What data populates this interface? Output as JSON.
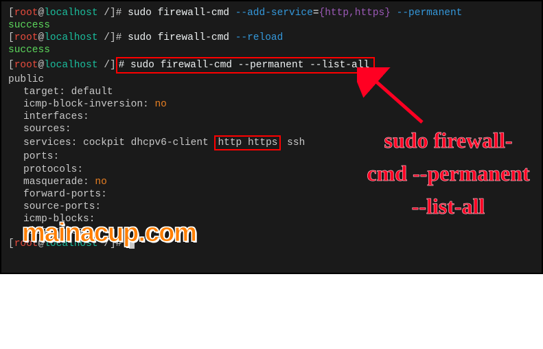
{
  "prompt": {
    "user": "root",
    "at": "@",
    "host": "localhost",
    "path": " /",
    "suffix": "]# "
  },
  "lines": {
    "cmd1_sudo": "sudo ",
    "cmd1_fw": "firewall-cmd ",
    "cmd1_add": "--add-service",
    "cmd1_eq": "=",
    "cmd1_val": "{http,https}",
    "cmd1_perm": " --permanent",
    "success": "success",
    "cmd2_sudo": "sudo ",
    "cmd2_fw": "firewall-cmd ",
    "cmd2_reload": "--reload",
    "cmd3_full": "# sudo firewall-cmd --permanent --list-all",
    "out_public": "public",
    "out_target": "target: default",
    "out_icmp": "icmp-block-inversion: ",
    "out_no": "no",
    "out_interfaces": "interfaces:",
    "out_sources": "sources:",
    "out_services_pre": "services: cockpit dhcpv6-client ",
    "out_services_hi": "http https",
    "out_services_post": " ssh",
    "out_ports": "ports:",
    "out_protocols": "protocols:",
    "out_masq": "masquerade: ",
    "out_fwdports": "forward-ports:",
    "out_srcports": "source-ports:",
    "out_icmpblocks": "icmp-blocks:",
    "out_rich": "rich rules:"
  },
  "watermark": "mainacup.com",
  "annotation": "sudo firewall-cmd --permanent --list-all"
}
